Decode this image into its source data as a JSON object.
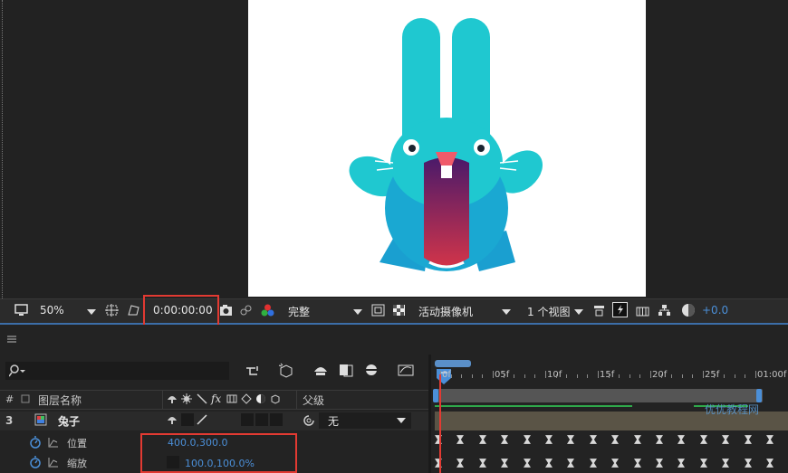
{
  "viewer": {
    "zoom": "50%",
    "timecode": "0:00:00:00",
    "resolution": "完整",
    "camera": "活动摄像机",
    "views": "1 个视图",
    "exposure": "+0.0"
  },
  "timeline": {
    "ruler_labels": [
      "0f",
      "05f",
      "10f",
      "15f",
      "20f",
      "25f",
      "01:00f"
    ],
    "columns": {
      "number": "#",
      "layer_name": "图层名称",
      "switches": "fx",
      "parent": "父级"
    },
    "layers": [
      {
        "index": "3",
        "name": "兔子",
        "parent": "无",
        "properties": [
          {
            "name": "位置",
            "value": "400.0,300.0"
          },
          {
            "name": "缩放",
            "value": "100.0,100.0%"
          }
        ]
      }
    ]
  },
  "watermark": "优优教程网",
  "colors": {
    "accent": "#3c6ea8",
    "highlight_box": "#e23a32",
    "value_blue": "#4b8fd8",
    "rabbit": "#1fc8d0",
    "mouth_top": "#4a1a6a",
    "mouth_bottom": "#d0344a"
  }
}
